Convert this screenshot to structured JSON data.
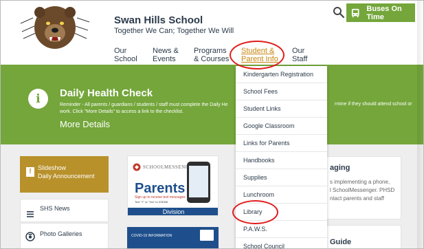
{
  "header": {
    "school_name": "Swan Hills School",
    "tagline": "Together We Can; Together We Will",
    "logo_icon": "bear-mascot-logo",
    "search_icon": "search-icon",
    "bus_button_label": "Buses On Time",
    "bus_icon": "bus-icon"
  },
  "nav": [
    {
      "line1": "Our",
      "line2": "School"
    },
    {
      "line1": "News &",
      "line2": "Events"
    },
    {
      "line1": "Programs",
      "line2": "& Courses"
    },
    {
      "line1": "Student &",
      "line2": "Parent Info"
    },
    {
      "line1": "Our",
      "line2": "Staff"
    }
  ],
  "alert": {
    "title": "Daily Health Check",
    "body_left": "Reminder - All parents / guardians / students / staff must complete the Daily He",
    "body_left_2": "work. Click \"More Details\" to access a link to the checklist.",
    "body_right": "rmine if they should attend school or",
    "more_details": "More Details",
    "icon": "info-icon"
  },
  "sidebar": {
    "slideshow_title": "Slideshow",
    "slideshow_subtitle": "Daily Announcement",
    "news_label": "SHS News",
    "gallery_label": "Photo Galleries"
  },
  "messenger_card": {
    "brand": "SCHOOLMESSENGER",
    "headline": "Parents",
    "signup": "Sign up to receive text messages",
    "textline": "Text \"Y\" or \"Yes\" to 978338",
    "footer": "Division"
  },
  "covid_card": {
    "label": "COVID-19 INFORMATION"
  },
  "right_cards": {
    "card1_title": "aging",
    "card1_lines": [
      "s implementing a phone,",
      "l SchoolMessenger. PHSD",
      "ntact parents and staff"
    ],
    "card2_title": "Guide"
  },
  "dropdown": [
    "Kindergarten Registration",
    "School Fees",
    "Student Links",
    "Google Classroom",
    "Links for Parents",
    "Handbooks",
    "Supplies",
    "Lunchroom",
    "Library",
    "P.A.W.S.",
    "School Council"
  ],
  "colors": {
    "brand_green": "#74a63b",
    "accent_orange": "#c8860e",
    "highlight_red": "#e01b1b",
    "slideshow_gold": "#b8912b",
    "navy": "#1e4f8c"
  }
}
